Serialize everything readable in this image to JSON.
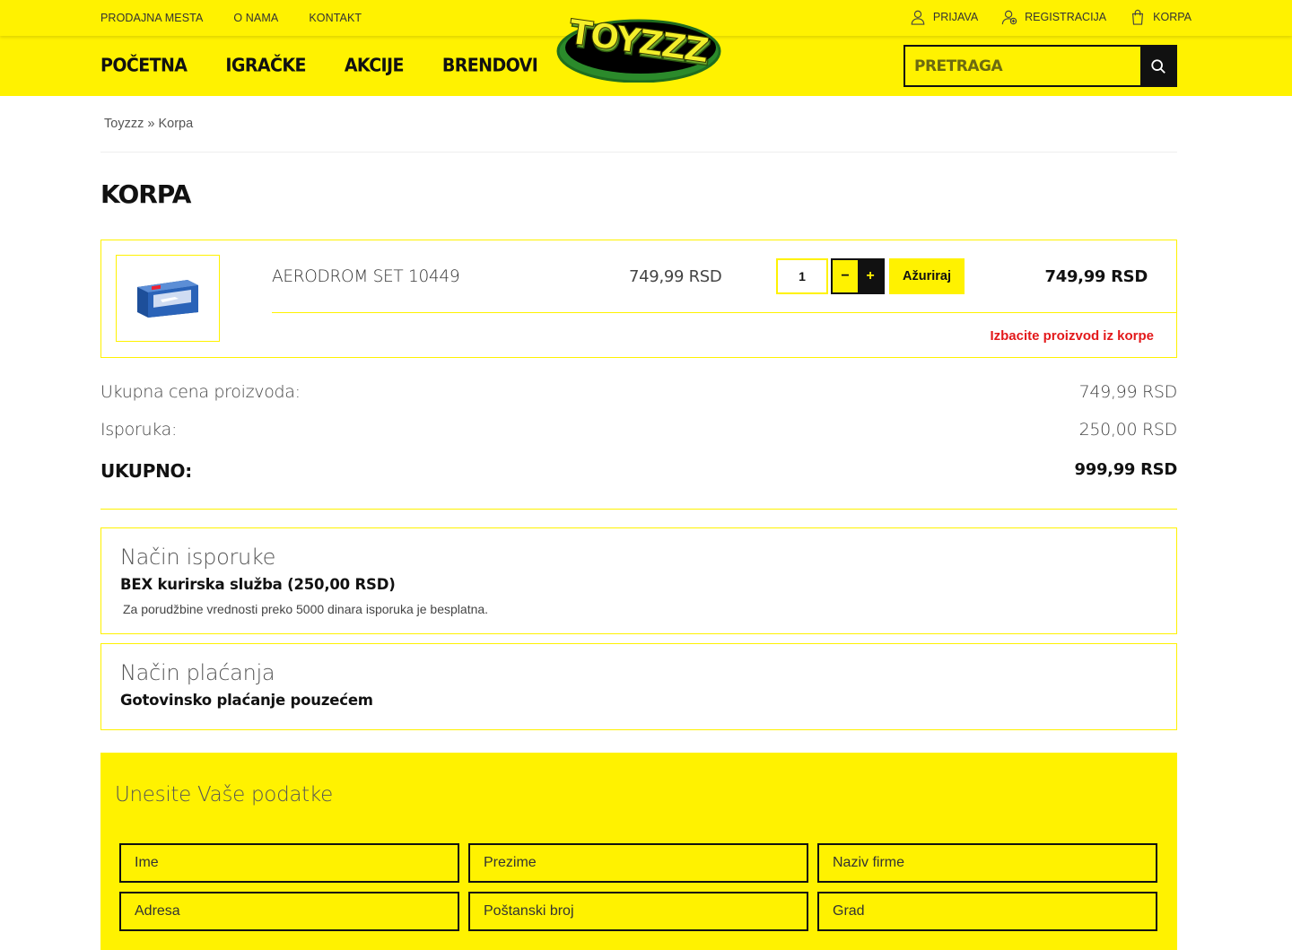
{
  "topbar": {
    "links": [
      "PRODAJNA MESTA",
      "O NAMA",
      "KONTAKT"
    ],
    "account": {
      "login": "PRIJAVA",
      "register": "REGISTRACIJA",
      "cart": "KORPA"
    }
  },
  "nav": {
    "items": [
      "POČETNA",
      "IGRAČKE",
      "AKCIJE",
      "BRENDOVI"
    ]
  },
  "logo": {
    "text": "TOYZZZ"
  },
  "search": {
    "placeholder": "PRETRAGA"
  },
  "breadcrumb": {
    "home": "Toyzzz",
    "separator": "»",
    "current": "Korpa"
  },
  "page": {
    "title": "KORPA"
  },
  "cart": {
    "item": {
      "name": "AERODROM SET 10449",
      "unit_price": "749,99 RSD",
      "quantity": "1",
      "minus": "−",
      "plus": "+",
      "update_label": "Ažuriraj",
      "line_total": "749,99 RSD",
      "remove_label": "Izbacite proizvod iz korpe"
    }
  },
  "summary": {
    "products_label": "Ukupna cena proizvoda:",
    "products_value": "749,99 RSD",
    "shipping_label": "Isporuka:",
    "shipping_value": "250,00 RSD",
    "total_label": "UKUPNO:",
    "total_value": "999,99 RSD"
  },
  "delivery": {
    "heading": "Način isporuke",
    "method": "BEX kurirska služba (250,00 RSD)",
    "note": "Za porudžbine vrednosti preko 5000 dinara isporuka je besplatna."
  },
  "payment": {
    "heading": "Način plaćanja",
    "method": "Gotovinsko plaćanje pouzećem"
  },
  "form": {
    "title": "Unesite Vaše podatke",
    "fields": {
      "first_name": "Ime",
      "last_name": "Prezime",
      "company": "Naziv firme",
      "address": "Adresa",
      "postal": "Poštanski broj",
      "city": "Grad"
    }
  },
  "colors": {
    "brand_yellow": "#fff200",
    "dark": "#111111",
    "remove_red": "#e3191b",
    "logo_green": "#2b8a2b"
  }
}
